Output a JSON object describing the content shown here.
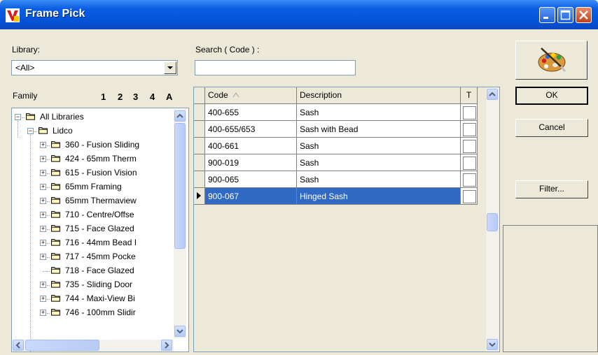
{
  "window": {
    "title": "Frame Pick"
  },
  "library": {
    "label": "Library:",
    "value": "<All>"
  },
  "search": {
    "label": "Search ( Code ) :",
    "value": ""
  },
  "family": {
    "label": "Family",
    "tabs": [
      "1",
      "2",
      "3",
      "4",
      "A"
    ],
    "tree": [
      {
        "label": "All Libraries",
        "level": 0,
        "expander": "minus"
      },
      {
        "label": "Lidco",
        "level": 1,
        "expander": "minus"
      },
      {
        "label": "360 - Fusion Sliding",
        "level": 2,
        "expander": "plus"
      },
      {
        "label": "424 - 65mm Therm",
        "level": 2,
        "expander": "plus"
      },
      {
        "label": "615 - Fusion Vision",
        "level": 2,
        "expander": "plus"
      },
      {
        "label": "65mm Framing",
        "level": 2,
        "expander": "plus"
      },
      {
        "label": "65mm Thermaview",
        "level": 2,
        "expander": "plus"
      },
      {
        "label": "710 - Centre/Offse",
        "level": 2,
        "expander": "plus"
      },
      {
        "label": "715 - Face Glazed",
        "level": 2,
        "expander": "plus"
      },
      {
        "label": "716 - 44mm Bead I",
        "level": 2,
        "expander": "plus"
      },
      {
        "label": "717 - 45mm Pocke",
        "level": 2,
        "expander": "plus"
      },
      {
        "label": "718 - Face Glazed",
        "level": 2,
        "expander": "none"
      },
      {
        "label": "735 - Sliding Door",
        "level": 2,
        "expander": "plus"
      },
      {
        "label": "744 - Maxi-View Bi",
        "level": 2,
        "expander": "plus"
      },
      {
        "label": "746 - 100mm Slidir",
        "level": 2,
        "expander": "plus"
      }
    ]
  },
  "grid": {
    "columns": {
      "code": "Code",
      "description": "Description",
      "t": "T"
    },
    "rows": [
      {
        "code": "400-655",
        "description": "Sash",
        "selected": false
      },
      {
        "code": "400-655/653",
        "description": "Sash with Bead",
        "selected": false
      },
      {
        "code": "400-661",
        "description": "Sash",
        "selected": false
      },
      {
        "code": "900-019",
        "description": "Sash",
        "selected": false
      },
      {
        "code": "900-065",
        "description": "Sash",
        "selected": false
      },
      {
        "code": "900-067",
        "description": "Hinged Sash",
        "selected": true
      }
    ]
  },
  "buttons": {
    "ok": "OK",
    "cancel": "Cancel",
    "filter": "Filter..."
  },
  "colors": {
    "title_bar": "#0554d8",
    "selection": "#316ac5",
    "face": "#ece9d8"
  }
}
